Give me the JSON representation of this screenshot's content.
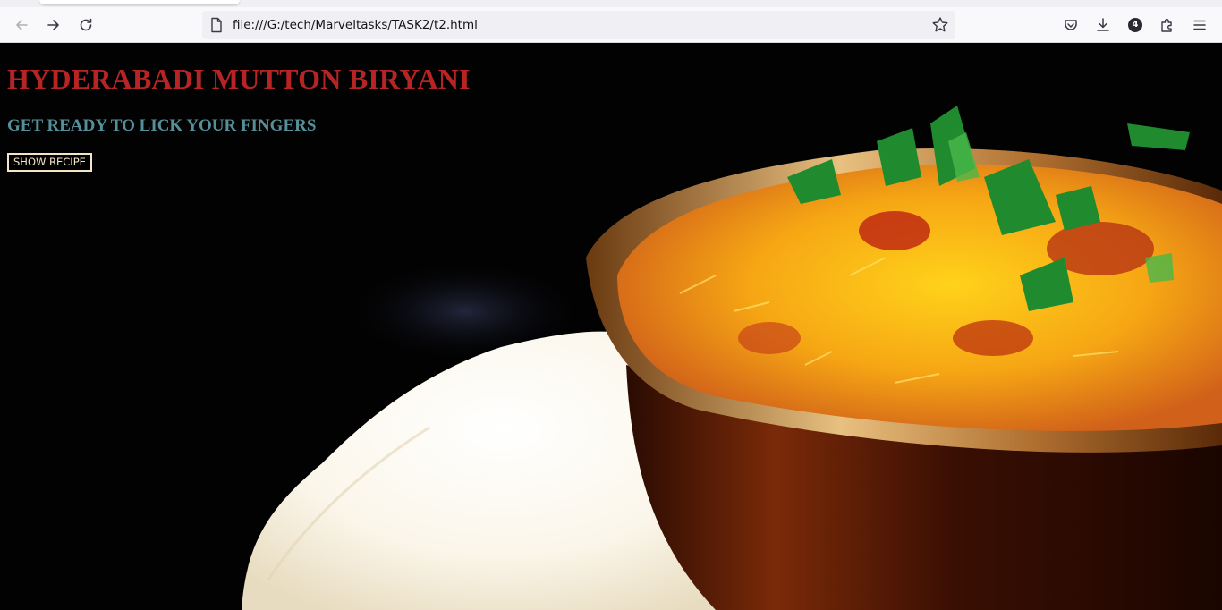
{
  "browser": {
    "url": "file:///G:/tech/Marveltasks/TASK2/t2.html",
    "extensions_badge": "4",
    "icons": [
      "back-icon",
      "forward-icon",
      "reload-icon",
      "page-icon",
      "bookmark-star-icon",
      "pocket-icon",
      "download-icon",
      "extensions-icon",
      "menu-icon"
    ]
  },
  "page": {
    "title": "HYDERABADI MUTTON BIRYANI",
    "subtitle": "GET READY TO LICK YOUR FINGERS",
    "button_label": "SHOW RECIPE",
    "colors": {
      "background": "#000000",
      "title": "#b62424",
      "subtitle": "#55909a",
      "button_border": "#f4e6c4"
    }
  }
}
